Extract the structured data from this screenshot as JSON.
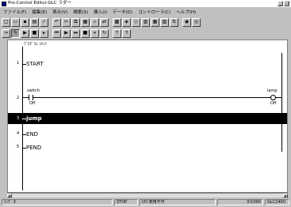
{
  "window": {
    "title": "Pro-Control Editor-GLC ラダー",
    "buttons": [
      "_",
      "□"
    ]
  },
  "menu": [
    "ファイル(F)",
    "編集(E)",
    "表示(V)",
    "検索(S)",
    "挿入(I)",
    "データ(D)",
    "コントローラ(C)",
    "ヘルプ(H)"
  ],
  "toolbar1": [
    {
      "name": "new-icon",
      "glyph": "□"
    },
    {
      "name": "open-icon",
      "glyph": "▭"
    },
    {
      "name": "save-icon",
      "glyph": "▪"
    },
    {
      "name": "print-icon",
      "glyph": "▤"
    },
    {
      "name": "check-icon",
      "glyph": "✓"
    },
    {
      "name": "undo-icon",
      "glyph": "↶"
    },
    {
      "name": "cut-icon",
      "glyph": "✂"
    },
    {
      "name": "copy-icon",
      "glyph": "⧉"
    },
    {
      "name": "paste-icon",
      "glyph": "▦"
    },
    {
      "name": "find-icon",
      "glyph": "⌕"
    },
    {
      "name": "replace-icon",
      "glyph": "⇄"
    },
    {
      "name": "symbol-icon",
      "glyph": "▩"
    },
    {
      "name": "monitor-icon",
      "glyph": "◈"
    },
    {
      "name": "zoom-icon",
      "glyph": "◇"
    },
    {
      "name": "list-icon",
      "glyph": "▥"
    },
    {
      "name": "grid-icon",
      "glyph": "▦"
    },
    {
      "name": "chart-icon",
      "glyph": "▧"
    },
    {
      "name": "transfer-icon",
      "glyph": "⇅"
    },
    {
      "name": "settings-icon",
      "glyph": "◉"
    },
    {
      "name": "help-icon",
      "glyph": "◎"
    }
  ],
  "toolbar2": [
    {
      "name": "online-mode-icon",
      "glyph": "⇒"
    },
    {
      "name": "edit-mode-icon",
      "glyph": "✎"
    },
    {
      "name": "run-mode-icon",
      "glyph": "▶"
    },
    {
      "name": "stop-mode-icon",
      "glyph": "■"
    },
    {
      "name": "step-mode-icon",
      "glyph": "▸"
    },
    {
      "name": "rewind-icon",
      "glyph": "⏮"
    },
    {
      "name": "play-icon",
      "glyph": "▶"
    },
    {
      "name": "fast-forward-icon",
      "glyph": "⏭"
    },
    {
      "name": "stop-icon",
      "glyph": "■"
    },
    {
      "name": "pause-icon",
      "glyph": "⏸"
    },
    {
      "name": "reset-icon",
      "glyph": "↻"
    },
    {
      "name": "up-arrow-icon",
      "glyph": "↑"
    },
    {
      "name": "upload-icon",
      "glyph": "⇑"
    }
  ],
  "editor": {
    "program_comment": "ﾌﾟﾛｸﾞﾗﾑ ｺﾒﾝﾄ",
    "rungs": [
      {
        "num": "1",
        "label": "START"
      },
      {
        "num": "2",
        "contact_name": "switch",
        "contact_state": "Off",
        "coil_name": "lamp",
        "coil_state": "Off"
      },
      {
        "num": "3",
        "label": "jump"
      },
      {
        "num": "4",
        "label": "END"
      },
      {
        "num": "5",
        "label": "PEND"
      }
    ]
  },
  "status": {
    "rung": "ﾗﾝｸﾞ 3",
    "mode": "STOP",
    "io": "I/O 使用不可",
    "count": "0/1000",
    "model": "GLC2400"
  },
  "colors": {
    "selection": "#000000",
    "panel": "#c0c0c0"
  }
}
